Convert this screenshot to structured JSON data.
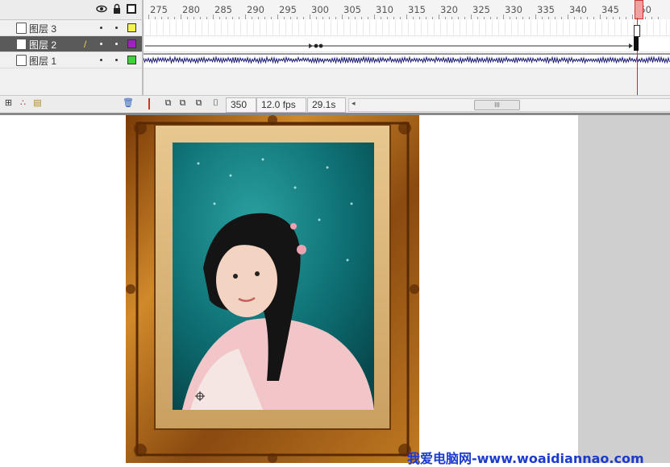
{
  "timeline": {
    "ruler_ticks": [
      "275",
      "280",
      "285",
      "290",
      "295",
      "300",
      "305",
      "310",
      "315",
      "320",
      "325",
      "330",
      "335",
      "340",
      "345",
      "350"
    ],
    "header_icons": {
      "eye": "eye-icon",
      "lock": "lock-icon",
      "outline": "outline-square-icon"
    },
    "layers": [
      {
        "name": "图层 3",
        "color": "#f6f050",
        "selected": false
      },
      {
        "name": "图层 2",
        "color": "#a020c0",
        "selected": true
      },
      {
        "name": "图层 1",
        "color": "#40d040",
        "selected": false
      }
    ]
  },
  "status_bar": {
    "frame": "350",
    "fps": "12.0 fps",
    "time": "29.1s",
    "scroll_thumb": "III"
  },
  "watermark": "我爱电脑网-www.woaidiannao.com",
  "colors": {
    "selected_layer": "#5a5a5a",
    "playhead": "#d22222",
    "waveform": "#1b1b6e",
    "frame_gold": "#b06a1a",
    "pasteboard": "#cfcfcf"
  }
}
